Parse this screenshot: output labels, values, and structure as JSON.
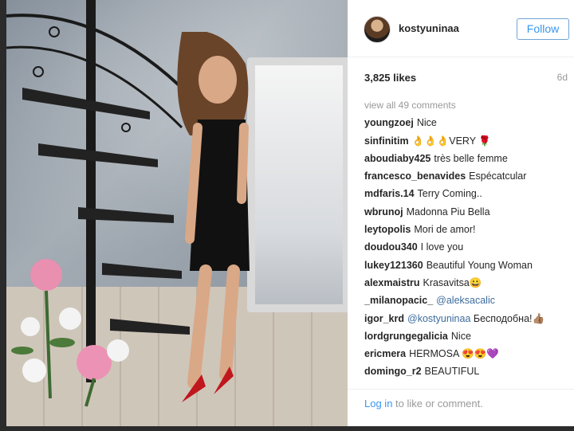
{
  "post": {
    "username": "kostyuninaa",
    "follow_label": "Follow",
    "likes": "3,825 likes",
    "time_ago": "6d",
    "view_all_comments": "view all 49 comments"
  },
  "comments": [
    {
      "user": "youngzoej",
      "text": "Nice"
    },
    {
      "user": "sinfinitim",
      "text": "👌👌👌VERY 🌹"
    },
    {
      "user": "aboudiaby425",
      "text": "très belle femme"
    },
    {
      "user": "francesco_benavides",
      "text": "Espécatcular"
    },
    {
      "user": "mdfaris.14",
      "text": "Terry Coming.."
    },
    {
      "user": "wbrunoj",
      "text": "Madonna Piu Bella"
    },
    {
      "user": "leytopolis",
      "text": "Mori de amor!"
    },
    {
      "user": "doudou340",
      "text": "I love you"
    },
    {
      "user": "lukey121360",
      "text": "Beautiful Young Woman"
    },
    {
      "user": "alexmaistru",
      "text": "Krasavitsa😀"
    },
    {
      "user": "_milanopacic_",
      "mention": "@aleksacalic",
      "text": ""
    },
    {
      "user": "igor_krd",
      "mention": "@kostyuninaa",
      "text": "Бесподобна!👍🏽"
    },
    {
      "user": "lordgrungegalicia",
      "text": "Nice"
    },
    {
      "user": "ericmera",
      "text": "HERMOSA 😍😍💜"
    },
    {
      "user": "domingo_r2",
      "text": "BEAUTIFUL"
    }
  ],
  "footer": {
    "login_link": "Log in",
    "login_rest": " to like or comment."
  },
  "colors": {
    "accent": "#3897f0",
    "mention": "#3d6c9e"
  }
}
